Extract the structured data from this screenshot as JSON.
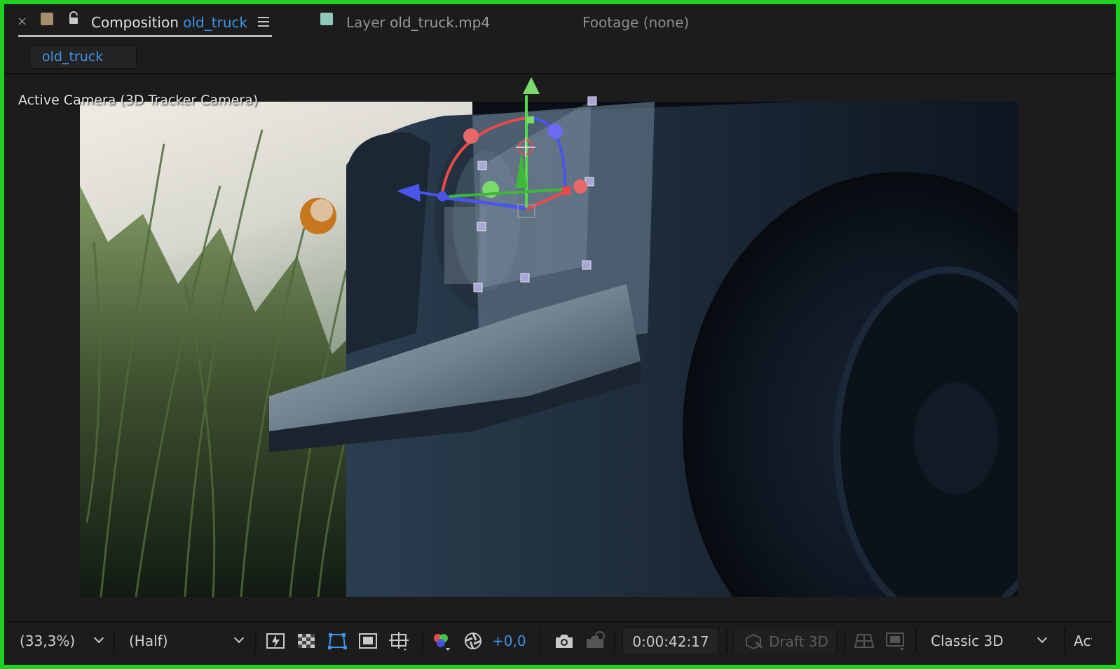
{
  "tabs": {
    "composition": {
      "prefix": "Composition",
      "name": "old_truck",
      "close": "×"
    },
    "layer": {
      "prefix": "Layer",
      "name": "old_truck.mp4"
    },
    "footage": {
      "label": "Footage (none)"
    }
  },
  "subtab": {
    "label": "old_truck"
  },
  "viewer": {
    "camera_label": "Active Camera (3D Tracker Camera)"
  },
  "toolbar": {
    "zoom": "(33,3%)",
    "resolution": "(Half)",
    "exposure": "+0,0",
    "timecode": "0:00:42:17",
    "draft3d": "Draft 3D",
    "renderer": "Classic 3D",
    "view": "Active Camera"
  },
  "icons": {
    "close": "close-icon",
    "composition_swatch": "composition-color-swatch",
    "lock": "lock-icon",
    "menu": "hamburger-menu-icon",
    "layer_swatch": "layer-color-swatch"
  },
  "colors": {
    "frame_border": "#1fd11f",
    "accent": "#3c95e8",
    "gizmo_x": "#e84a4a",
    "gizmo_y": "#55d84a",
    "gizmo_z": "#4a56ea"
  }
}
